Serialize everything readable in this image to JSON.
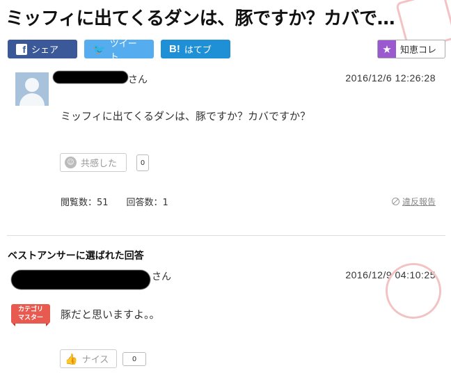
{
  "question": {
    "title": "ミッフィに出てくるダンは、豚ですか？カバで…",
    "user_suffix": "さん",
    "date": "2016/12/6  12:26:28",
    "body": "ミッフィに出てくるダンは、豚ですか？カバですか？",
    "empathy_label": "共感した",
    "empathy_count": "0",
    "views": "閲覧数：51",
    "answers": "回答数：1",
    "report_label": "違反報告"
  },
  "share": {
    "facebook_label": "シェア",
    "twitter_label": "ツイート",
    "hatena_icon": "B!",
    "hatena_label": "はてブ",
    "chiekore_label": "知恵コレ"
  },
  "best_answer": {
    "heading": "ベストアンサーに選ばれた回答",
    "user_suffix": "さん",
    "date": "2016/12/9  04:10:25",
    "badge_line1": "カテゴリ",
    "badge_line2": "マスター",
    "body": "豚だと思いますよ。。",
    "nice_label": "ナイス",
    "nice_count": "0"
  },
  "colors": {
    "facebook": "#3b5998",
    "twitter": "#55acee",
    "hatena": "#1f8fd6",
    "chiekore": "#9b59d0",
    "badge": "#e85a4f"
  }
}
